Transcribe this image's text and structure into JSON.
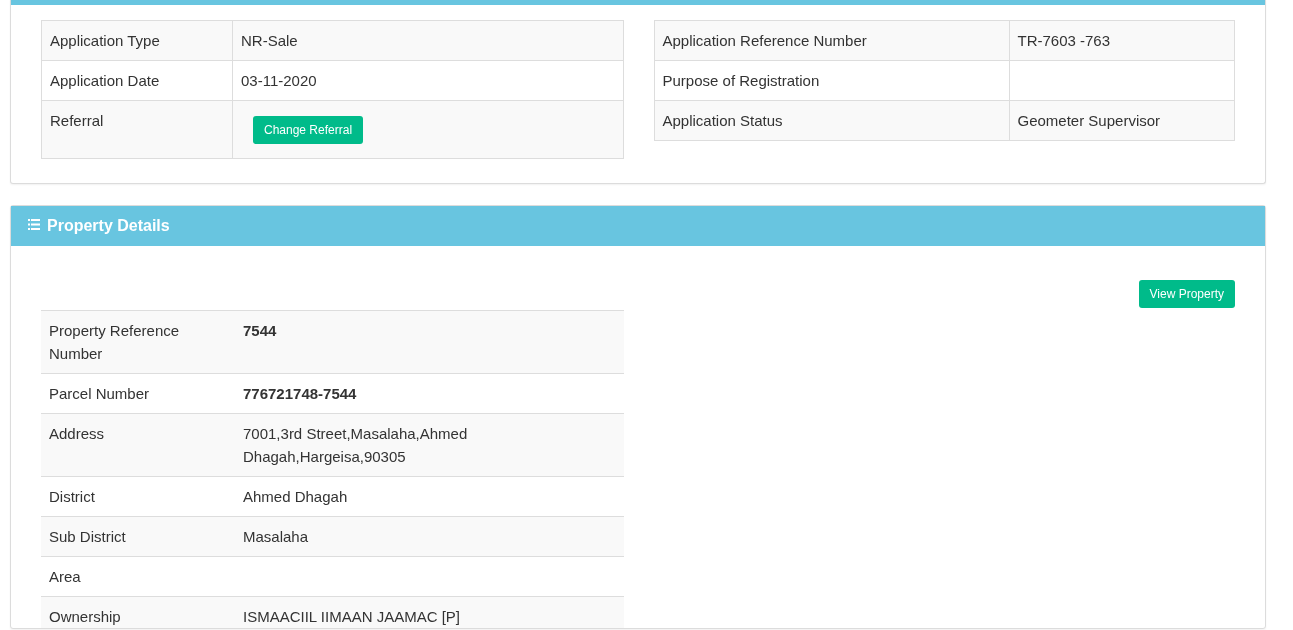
{
  "application_card": {
    "left_table": [
      {
        "label": "Application Type",
        "kind": "text",
        "value": "NR-Sale"
      },
      {
        "label": "Application Date",
        "kind": "text",
        "value": "03-11-2020"
      },
      {
        "label": "Referral",
        "kind": "button",
        "value": "Change Referral"
      }
    ],
    "right_table": [
      {
        "label": "Application Reference Number",
        "kind": "text",
        "value": "TR-7603 -763"
      },
      {
        "label": "Purpose of Registration",
        "kind": "text"
      },
      {
        "label": "Application Status",
        "kind": "text",
        "value": "Geometer Supervisor"
      }
    ]
  },
  "property_card": {
    "title": "Property Details",
    "button": "View Property",
    "rows": [
      {
        "label": "Property Reference Number",
        "value": "7544",
        "bold": true
      },
      {
        "label": "Parcel Number",
        "value": "776721748-7544",
        "bold": true
      },
      {
        "label": "Address",
        "value": "7001,3rd Street,Masalaha,Ahmed Dhagah,Hargeisa,90305",
        "bold": false
      },
      {
        "label": "District",
        "value": "Ahmed Dhagah",
        "bold": false
      },
      {
        "label": "Sub District",
        "value": "Masalaha",
        "bold": false
      },
      {
        "label": "Area"
      },
      {
        "label": "Ownership",
        "value": "ISMAACIIL IIMAAN JAAMAC [P]",
        "bold": false
      }
    ]
  }
}
